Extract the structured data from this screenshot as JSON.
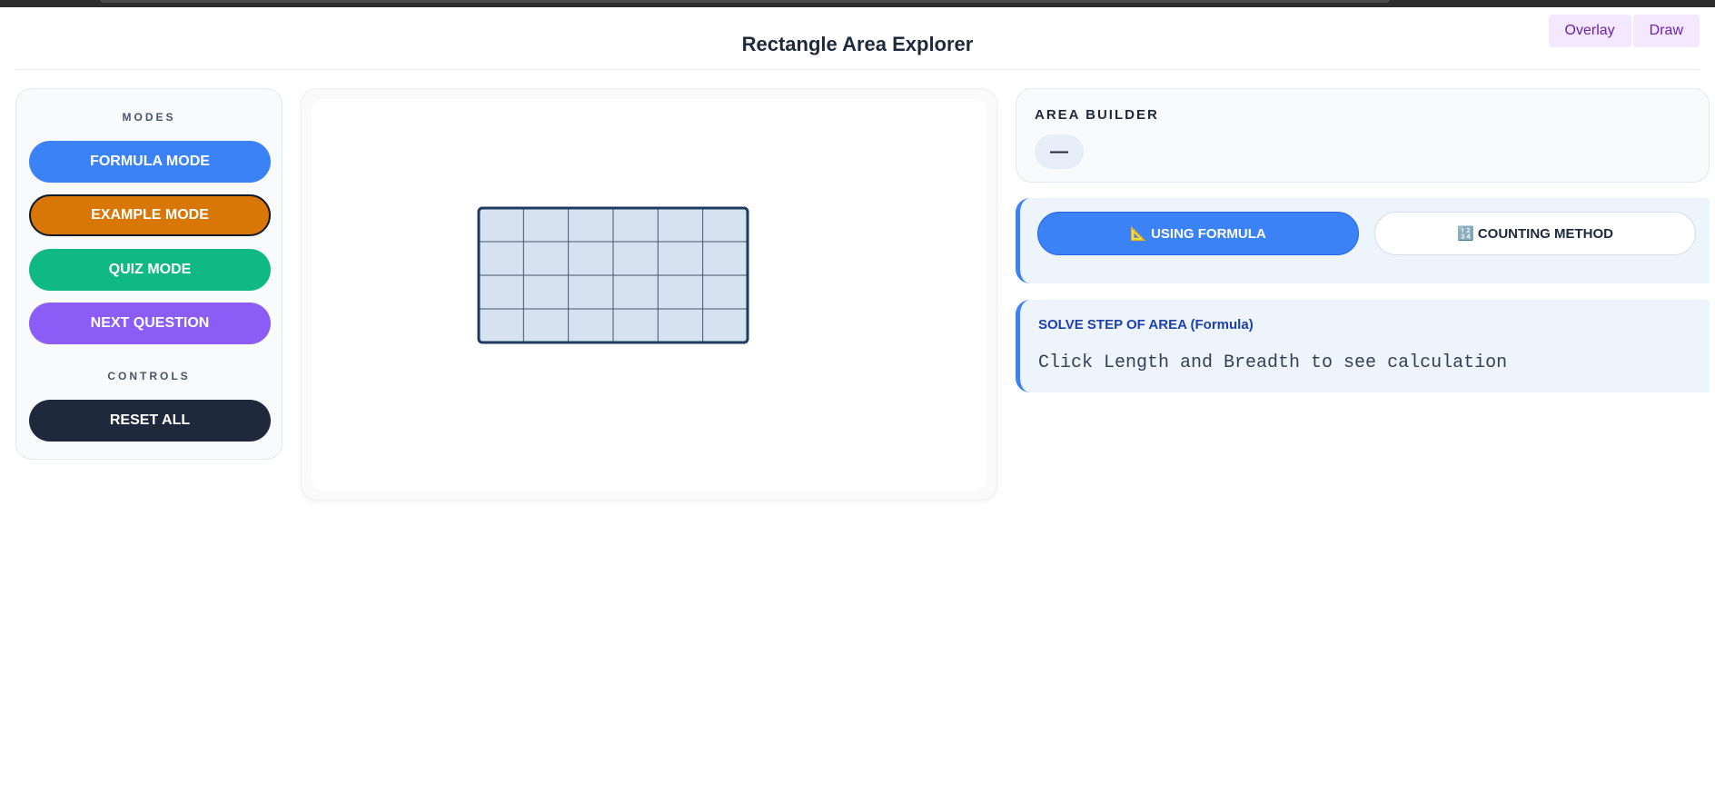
{
  "app": {
    "title": "Rectangle Area Explorer"
  },
  "overlay": {
    "overlay_label": "Overlay",
    "draw_label": "Draw"
  },
  "sidebar": {
    "modes_label": "MODES",
    "controls_label": "CONTROLS",
    "buttons": [
      {
        "label": "FORMULA MODE",
        "color": "#3b82f6"
      },
      {
        "label": "EXAMPLE MODE",
        "color": "#d97706"
      },
      {
        "label": "QUIZ MODE",
        "color": "#10b981"
      },
      {
        "label": "NEXT QUESTION",
        "color": "#8b5cf6"
      }
    ],
    "reset_label": "RESET ALL",
    "reset_color": "#1e293b"
  },
  "canvas": {
    "grid": {
      "columns": 6,
      "rows": 4
    },
    "fill_color": "#d6e2f0",
    "border_color": "#1e3a5f"
  },
  "builder": {
    "title": "AREA BUILDER",
    "value": "—"
  },
  "method": {
    "formula_icon": "triangular-ruler-icon",
    "formula_label": "📐 USING FORMULA",
    "counting_icon": "numbers-icon",
    "counting_label": "🔢 COUNTING METHOD"
  },
  "solve": {
    "title": "SOLVE STEP OF AREA (Formula)",
    "text": "Click Length and Breadth to see calculation"
  }
}
